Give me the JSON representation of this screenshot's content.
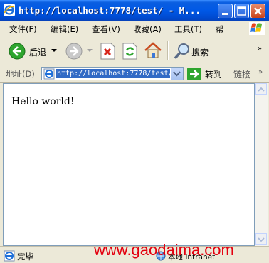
{
  "window": {
    "title": "http://localhost:7778/test/ - M...",
    "caption_buttons": [
      "minimize",
      "maximize",
      "close"
    ]
  },
  "menu": {
    "items": [
      "文件(F)",
      "编辑(E)",
      "查看(V)",
      "收藏(A)",
      "工具(T)",
      "帮"
    ]
  },
  "toolbar": {
    "back_label": "后退",
    "search_label": "搜索"
  },
  "address": {
    "label": "地址(D)",
    "value": "http://localhost:7778/test/",
    "go_label": "转到",
    "links_label": "链接"
  },
  "page": {
    "content_text": "Hello world!"
  },
  "status": {
    "text": "完毕",
    "zone": "本地 Intranet"
  },
  "watermark": {
    "text": "www.gaodaima.com"
  },
  "colors": {
    "titlebar": "#0058e6",
    "selection": "#316ac5",
    "watermark": "#e3000f"
  }
}
